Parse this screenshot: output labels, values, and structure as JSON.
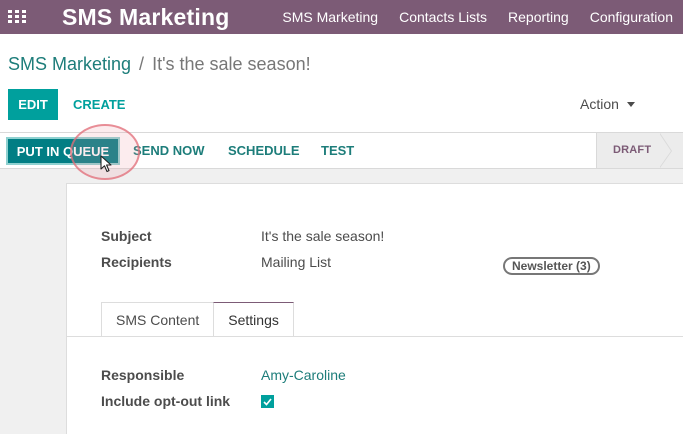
{
  "app": {
    "brand": "SMS Marketing",
    "menu": [
      "SMS Marketing",
      "Contacts Lists",
      "Reporting",
      "Configuration"
    ]
  },
  "breadcrumb": {
    "parent": "SMS Marketing",
    "separator": "/",
    "current": "It's the sale season!"
  },
  "control": {
    "edit_label": "EDIT",
    "create_label": "CREATE",
    "action_label": "Action"
  },
  "statusbar": {
    "queue_label": "PUT IN QUEUE",
    "send_now_label": "SEND NOW",
    "schedule_label": "SCHEDULE",
    "test_label": "TEST",
    "stage_label": "DRAFT"
  },
  "form": {
    "subject_label": "Subject",
    "subject_value": "It's the sale season!",
    "recipients_label": "Recipients",
    "recipients_value": "Mailing List",
    "recipients_badge": "Newsletter (3)",
    "tabs": [
      {
        "label": "SMS Content",
        "active": false
      },
      {
        "label": "Settings",
        "active": true
      }
    ],
    "responsible_label": "Responsible",
    "responsible_value": "Amy-Caroline",
    "optout_label": "Include opt-out link",
    "optout_checked": true
  },
  "colors": {
    "navbar": "#7c5b76",
    "primary": "#00a09d",
    "link": "#1d7d7a"
  }
}
